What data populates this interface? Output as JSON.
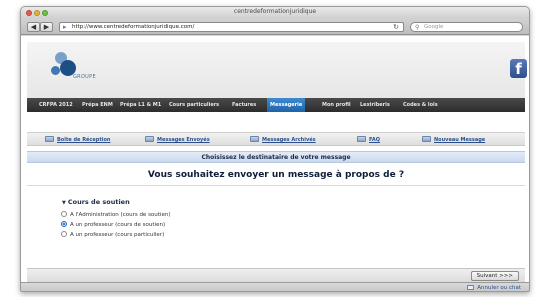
{
  "window": {
    "title": "centredeformationjuridique"
  },
  "browser": {
    "back_icon": "back-arrow-icon",
    "forward_icon": "forward-arrow-icon",
    "url": "http://www.centredeformationjuridique.com/",
    "search_placeholder": "Google"
  },
  "header": {
    "logo_text": "GROUPE",
    "facebook_letter": "f"
  },
  "main_nav": {
    "items": [
      {
        "label": "CRFPA 2012"
      },
      {
        "label": "Prépa ENM"
      },
      {
        "label": "Prépa L1 & M1"
      },
      {
        "label": "Cours particuliers"
      },
      {
        "label": "Factures"
      },
      {
        "label": "Messagerie"
      },
      {
        "label": "Mon profil"
      },
      {
        "label": "Lexiriberis"
      },
      {
        "label": "Codes & lois"
      }
    ],
    "active": "Messagerie"
  },
  "sub_tabs": [
    {
      "label": "Boîte de Réception"
    },
    {
      "label": "Messages Envoyés"
    },
    {
      "label": "Messages Archivés"
    },
    {
      "label": "FAQ"
    },
    {
      "label": "Nouveau Message"
    }
  ],
  "form": {
    "choose_label": "Choisissez le destinataire de votre message",
    "question": "Vous souhaitez envoyer un message à propos de ?",
    "fieldset_legend": "Cours de soutien",
    "options": [
      {
        "label": "A l'Administration (cours de soutien)",
        "selected": false
      },
      {
        "label": "A un professeur (cours de soutien)",
        "selected": true
      },
      {
        "label": "A un professeur (cours particulier)",
        "selected": false
      }
    ],
    "next_label": "Suivant >>>"
  },
  "status": {
    "cart_label": "Annuler ou chat"
  }
}
